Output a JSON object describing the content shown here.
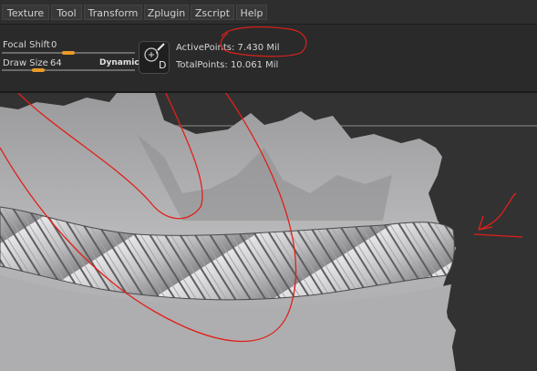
{
  "menu": {
    "items": [
      {
        "label": "Texture"
      },
      {
        "label": "Tool"
      },
      {
        "label": "Transform"
      },
      {
        "label": "Zplugin"
      },
      {
        "label": "Zscript"
      },
      {
        "label": "Help"
      }
    ]
  },
  "toolbar": {
    "focal_shift": {
      "label": "Focal Shift",
      "value": "0",
      "level": 0.5
    },
    "draw_size": {
      "label": "Draw Size",
      "value": "64",
      "level": 0.25
    },
    "dynamic_label": "Dynamic",
    "brush_letter": "D",
    "active_points": "ActivePoints: 7.430 Mil",
    "total_points": "TotalPoints: 10.061 Mil"
  },
  "colors": {
    "accent_orange": "#e89a28",
    "annotation_red": "#e0201a",
    "background": "#2b2b2b",
    "model_surface": "#b9b9bb"
  },
  "icons": [
    "brush-icon"
  ]
}
